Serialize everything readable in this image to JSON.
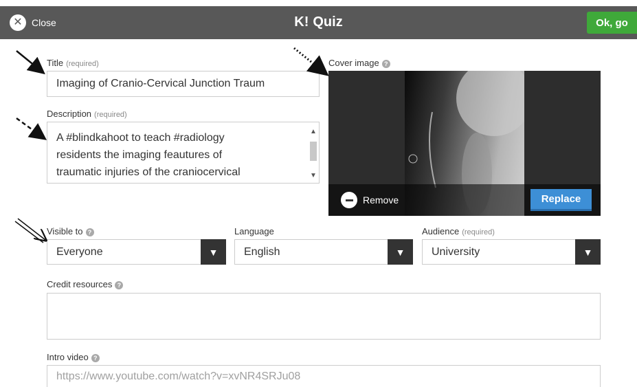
{
  "header": {
    "close_label": "Close",
    "logo": "K!",
    "title": "Quiz",
    "ok_label": "Ok, go"
  },
  "form": {
    "title_label": "Title",
    "title_required": "(required)",
    "title_value": "Imaging of Cranio-Cervical Junction Traum",
    "description_label": "Description",
    "description_required": "(required)",
    "description_lines": [
      "A #blindkahoot to teach #radiology",
      "residents the imaging feautures of",
      "traumatic injuries of the craniocervical"
    ],
    "cover_label": "Cover image",
    "cover_remove": "Remove",
    "cover_replace": "Replace",
    "visible_label": "Visible to",
    "visible_value": "Everyone",
    "language_label": "Language",
    "language_value": "English",
    "audience_label": "Audience",
    "audience_required": "(required)",
    "audience_value": "University",
    "credit_label": "Credit resources",
    "credit_value": "",
    "video_label": "Intro video",
    "video_placeholder": "https://www.youtube.com/watch?v=xvNR4SRJu08"
  },
  "icons": {
    "help": "?",
    "close": "✕",
    "dropdown": "▼",
    "scroll_up": "▲",
    "scroll_down": "▼"
  }
}
